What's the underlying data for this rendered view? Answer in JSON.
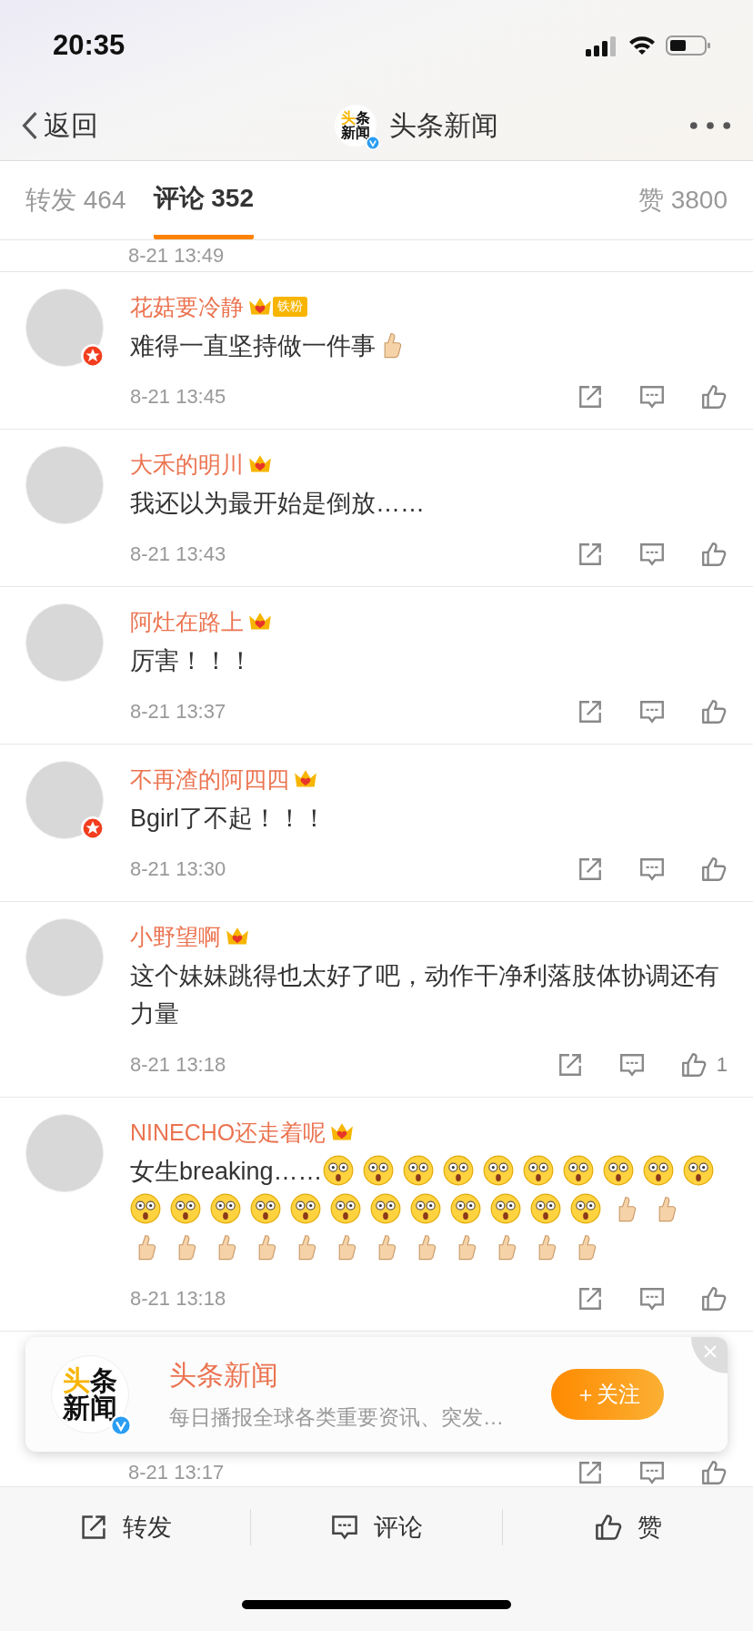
{
  "status_bar": {
    "time": "20:35"
  },
  "nav": {
    "back_label": "返回",
    "logo": {
      "accent": "头",
      "rest": "条",
      "bottom": "新闻",
      "verified": true
    },
    "title": "头条新闻"
  },
  "tabs": [
    {
      "label": "转发",
      "count": "464",
      "selected": false
    },
    {
      "label": "评论",
      "count": "352",
      "selected": true
    }
  ],
  "likes_tab": {
    "label": "赞",
    "count": "3800"
  },
  "partial_top": {
    "time": "8-21 13:49"
  },
  "comments": [
    {
      "name": "花菇要冷静",
      "crown": true,
      "fan_badge": "铁粉",
      "avatar_badge": true,
      "text": "难得一直坚持做一件事",
      "emojis": [
        {
          "kind": "thumbs_up"
        }
      ],
      "time": "8-21 13:45"
    },
    {
      "name": "大禾的明川",
      "crown": true,
      "avatar_badge": false,
      "text": "我还以为最开始是倒放……",
      "time": "8-21 13:43"
    },
    {
      "name": "阿灶在路上",
      "crown": true,
      "avatar_badge": false,
      "text": "厉害！！！",
      "time": "8-21 13:37"
    },
    {
      "name": "不再渣的阿四四",
      "crown": true,
      "avatar_badge": true,
      "text": "Bgirl了不起！！！",
      "time": "8-21 13:30"
    },
    {
      "name": "小野望啊",
      "crown": true,
      "avatar_badge": false,
      "text": "这个妹妹跳得也太好了吧，动作干净利落肢体协调还有力量",
      "time": "8-21 13:18",
      "like_count": "1"
    },
    {
      "name": "NINECHO还走着呢",
      "crown": true,
      "avatar_badge": false,
      "text": "女生breaking……",
      "emojis": [
        {
          "kind": "surprised"
        },
        {
          "kind": "surprised"
        },
        {
          "kind": "surprised"
        },
        {
          "kind": "surprised"
        },
        {
          "kind": "surprised"
        },
        {
          "kind": "surprised"
        },
        {
          "kind": "surprised"
        },
        {
          "kind": "surprised"
        },
        {
          "kind": "surprised"
        },
        {
          "kind": "surprised"
        },
        {
          "kind": "surprised"
        },
        {
          "kind": "surprised"
        },
        {
          "kind": "surprised"
        },
        {
          "kind": "surprised"
        },
        {
          "kind": "surprised"
        },
        {
          "kind": "surprised"
        },
        {
          "kind": "surprised"
        },
        {
          "kind": "surprised"
        },
        {
          "kind": "surprised"
        },
        {
          "kind": "surprised"
        },
        {
          "kind": "surprised"
        },
        {
          "kind": "surprised"
        },
        {
          "kind": "thumbs_up"
        },
        {
          "kind": "thumbs_up"
        },
        {
          "kind": "thumbs_up"
        },
        {
          "kind": "thumbs_up"
        },
        {
          "kind": "thumbs_up"
        },
        {
          "kind": "thumbs_up"
        },
        {
          "kind": "thumbs_up"
        },
        {
          "kind": "thumbs_up"
        },
        {
          "kind": "thumbs_up"
        },
        {
          "kind": "thumbs_up"
        },
        {
          "kind": "thumbs_up"
        },
        {
          "kind": "thumbs_up"
        },
        {
          "kind": "thumbs_up"
        },
        {
          "kind": "thumbs_up"
        }
      ],
      "time": "8-21 13:18"
    }
  ],
  "partial_bottom": {
    "time": "8-21 13:17"
  },
  "follow_card": {
    "logo": {
      "accent": "头",
      "rest": "条",
      "bottom": "新闻",
      "verified": true
    },
    "name": "头条新闻",
    "description": "每日播报全球各类重要资讯、突发…",
    "button": "＋关注"
  },
  "bottom_bar": [
    {
      "kind": "repost",
      "label": "转发"
    },
    {
      "kind": "comment",
      "label": "评论"
    },
    {
      "kind": "like",
      "label": "赞"
    }
  ]
}
